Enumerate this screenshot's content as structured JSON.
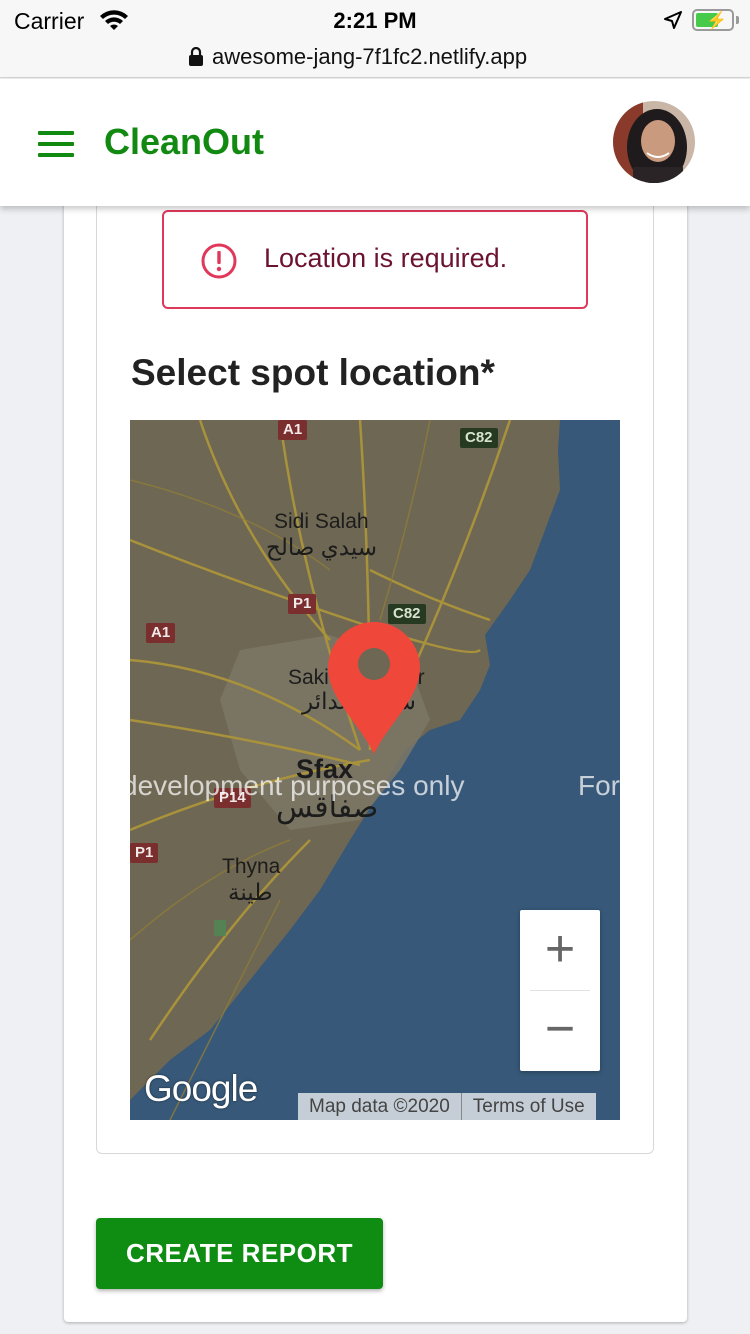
{
  "status_bar": {
    "carrier": "Carrier",
    "time": "2:21 PM"
  },
  "browser": {
    "url": "awesome-jang-7f1fc2.netlify.app"
  },
  "header": {
    "title": "CleanOut",
    "accent": "#128a12"
  },
  "alert": {
    "message": "Location is required.",
    "border_color": "#e0385a"
  },
  "section": {
    "heading": "Select spot location*"
  },
  "map": {
    "places": {
      "sidi_salah": "Sidi Salah",
      "sidi_salah_ar": "سيدي صالح",
      "sakiet": "Sakiet Eddaier",
      "sakiet_ar": "ساقية الدائر",
      "sfax": "Sfax",
      "sfax_ar": "صفاقس",
      "thyna": "Thyna",
      "thyna_ar": "طينة"
    },
    "roads": {
      "a1_top": "A1",
      "c82_top": "C82",
      "p1_mid": "P1",
      "c82_mid": "C82",
      "a1_left": "A1",
      "p14": "P14",
      "p1_left": "P1"
    },
    "watermark": "development purposes only",
    "watermark_right": "For",
    "zoom_in": "+",
    "zoom_out": "−",
    "logo": "Google",
    "attribution": "Map data ©2020",
    "terms": "Terms of Use"
  },
  "actions": {
    "create_report": "CREATE REPORT",
    "button_color": "#0f8c12"
  }
}
